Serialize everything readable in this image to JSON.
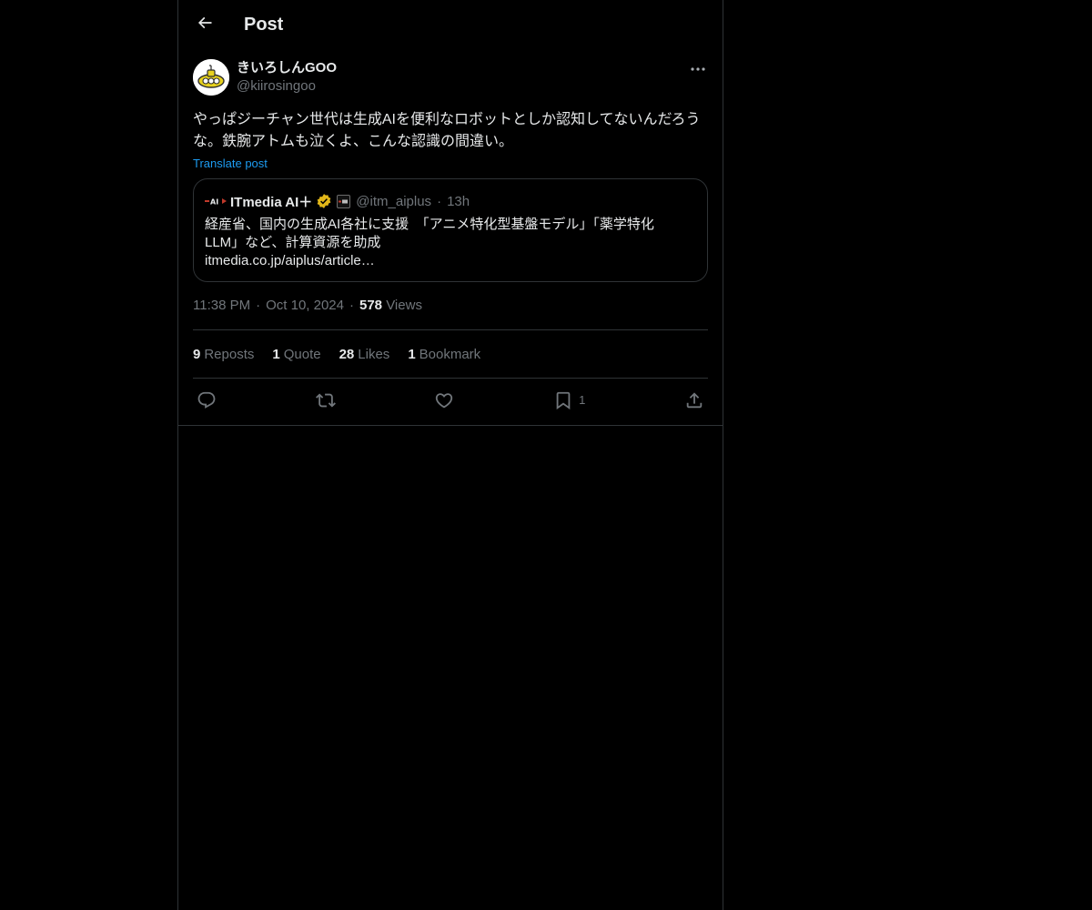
{
  "header": {
    "title": "Post"
  },
  "author": {
    "display_name": "きいろしんGOO",
    "handle": "@kiirosingoo",
    "avatar_icon": "yellow-submarine-avatar"
  },
  "post": {
    "text": "やっぱジーチャン世代は生成AIを便利なロボットとしか認知してないんだろうな。鉄腕アトムも泣くよ、こんな認識の間違い。",
    "translate_label": "Translate post"
  },
  "quote": {
    "name": "ITmedia AI＋",
    "logo_text": "AI",
    "handle": "@itm_aiplus",
    "dot": "·",
    "time": "13h",
    "lines": [
      "経産省、国内の生成AI各社に支援　「アニメ特化型基盤モデル」「薬学特化",
      "LLM」など、計算資源を助成",
      "itmedia.co.jp/aiplus/article…"
    ]
  },
  "meta": {
    "time": "11:38 PM",
    "sep1": "·",
    "date": "Oct 10, 2024",
    "sep2": "·",
    "views_count": "578",
    "views_label": "Views"
  },
  "stats": [
    {
      "count": "9",
      "label": "Reposts"
    },
    {
      "count": "1",
      "label": "Quote"
    },
    {
      "count": "28",
      "label": "Likes"
    },
    {
      "count": "1",
      "label": "Bookmark"
    }
  ],
  "actions": {
    "bookmark_count": "1"
  },
  "colors": {
    "background": "#000000",
    "text": "#e7e9ea",
    "muted": "#71767b",
    "border": "#2f3336",
    "accent": "#1d9bf0",
    "verified_gold": "#e2b719"
  }
}
